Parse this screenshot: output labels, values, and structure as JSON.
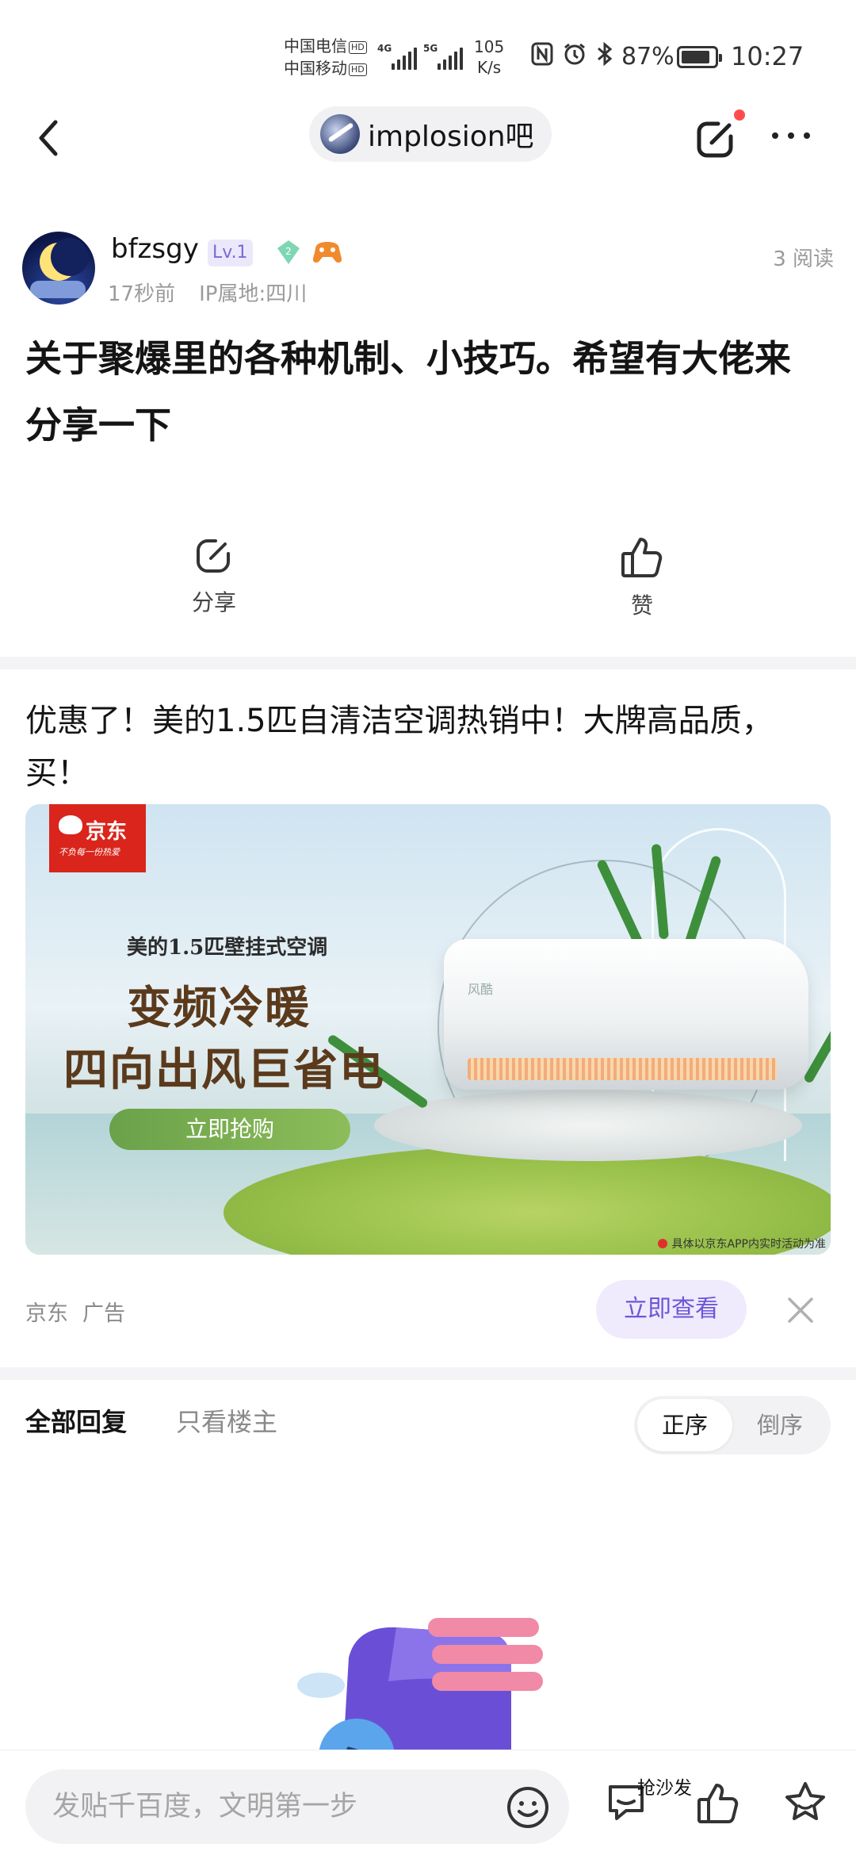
{
  "status_bar": {
    "carrier_1": "中国电信",
    "carrier_2": "中国移动",
    "hd_badge": "HD",
    "network_1": "4G",
    "network_2": "5G",
    "speed_value": "105",
    "speed_unit": "K/s",
    "battery_percent": "87%",
    "battery_level": 0.87,
    "time": "10:27"
  },
  "header": {
    "forum_name": "implosion吧",
    "has_notification_dot": true
  },
  "post": {
    "author": "bfzsgy",
    "level": "Lv.1",
    "badge_number": "2",
    "time_ago": "17秒前",
    "ip_location": "IP属地:四川",
    "read_count": "3 阅读",
    "title": "关于聚爆里的各种机制、小技巧。希望有大佬来分享一下",
    "share_label": "分享",
    "like_label": "赞"
  },
  "ad": {
    "title": "优惠了！美的1.5匹自清洁空调热销中！大牌高品质，买！",
    "jd_logo_text": "京东",
    "jd_slogan": "不负每一份热爱",
    "banner_sub": "美的1.5匹壁挂式空调",
    "banner_h1": "变频冷暖",
    "banner_h2": "四向出风巨省电",
    "banner_cta": "立即抢购",
    "unit_brand": "风酷",
    "banner_disclaimer": "具体以京东APP内实时活动为准",
    "source": "京东",
    "ad_label": "广告",
    "view_button": "立即查看"
  },
  "replies": {
    "tab_all": "全部回复",
    "tab_op_only": "只看楼主",
    "sort_asc": "正序",
    "sort_desc": "倒序"
  },
  "bottom_bar": {
    "input_placeholder": "发贴千百度，文明第一步",
    "sofa_label": "抢沙发"
  },
  "colors": {
    "accent_purple": "#6e56d8",
    "notification_red": "#ff4d4f",
    "jd_red": "#d9251c"
  }
}
